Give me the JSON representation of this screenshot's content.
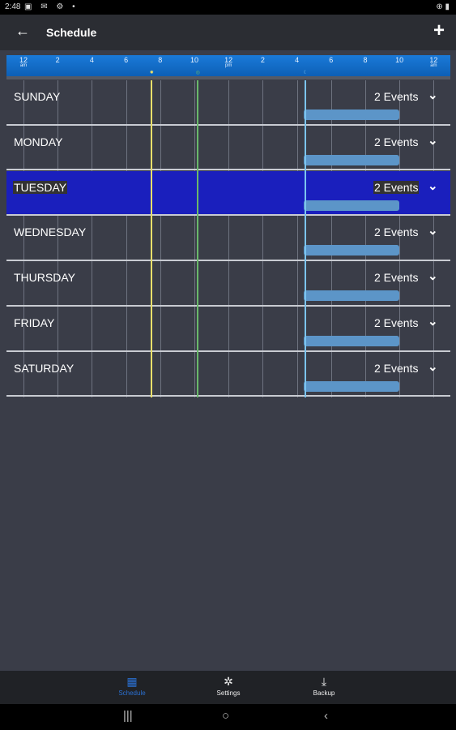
{
  "status_bar": {
    "time": "2:48",
    "left_icons": "▣ ✉ ⚙ •",
    "right_icons": "⊕ ▮"
  },
  "app_bar": {
    "back_icon": "←",
    "title": "Schedule",
    "add_icon": "+"
  },
  "timeline": {
    "ticks": [
      {
        "label": "12",
        "sub": "am"
      },
      {
        "label": "2",
        "sub": ""
      },
      {
        "label": "4",
        "sub": ""
      },
      {
        "label": "6",
        "sub": ""
      },
      {
        "label": "8",
        "sub": ""
      },
      {
        "label": "10",
        "sub": ""
      },
      {
        "label": "12",
        "sub": "pm"
      },
      {
        "label": "2",
        "sub": ""
      },
      {
        "label": "4",
        "sub": ""
      },
      {
        "label": "6",
        "sub": ""
      },
      {
        "label": "8",
        "sub": ""
      },
      {
        "label": "10",
        "sub": ""
      },
      {
        "label": "12",
        "sub": "am"
      }
    ],
    "markers": [
      {
        "icon": "✹",
        "hour": 7.5,
        "color": "#e8df6a"
      },
      {
        "icon": "◎",
        "hour": 10.2,
        "color": "#6ab86a"
      },
      {
        "icon": "☾",
        "hour": 16.5,
        "color": "#7cc4ee"
      }
    ]
  },
  "days": [
    {
      "name": "SUNDAY",
      "events": "2 Events"
    },
    {
      "name": "MONDAY",
      "events": "2 Events"
    },
    {
      "name": "TUESDAY",
      "events": "2 Events",
      "selected": true
    },
    {
      "name": "WEDNESDAY",
      "events": "2 Events"
    },
    {
      "name": "THURSDAY",
      "events": "2 Events"
    },
    {
      "name": "FRIDAY",
      "events": "2 Events"
    },
    {
      "name": "SATURDAY",
      "events": "2 Events"
    }
  ],
  "bottom_nav": [
    {
      "label": "Schedule",
      "icon": "▦",
      "active": true
    },
    {
      "label": "Settings",
      "icon": "✲"
    },
    {
      "label": "Backup",
      "icon": "⤓"
    }
  ],
  "system_nav": {
    "recents": "|||",
    "home": "○",
    "back": "‹"
  }
}
